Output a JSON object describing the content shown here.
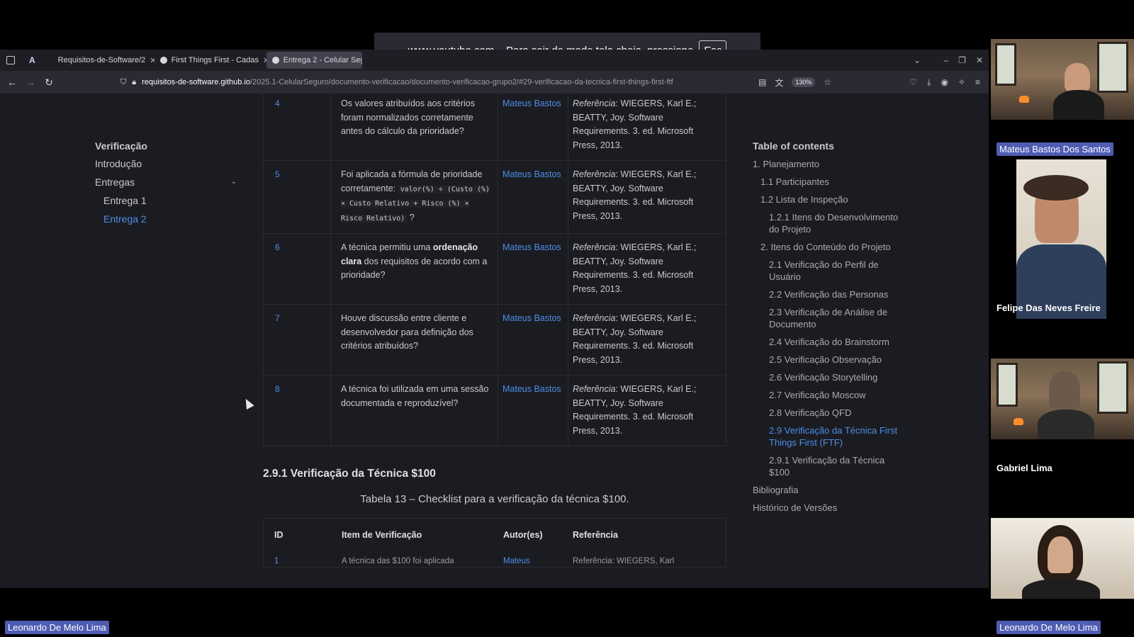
{
  "fullscreen_notice": {
    "text": "www.youtube.com – Para sair do modo tela cheia, pressione",
    "key": "Esc"
  },
  "browser": {
    "tabs": [
      {
        "label": "Requisitos-de-Software/2",
        "icon": "github-icon"
      },
      {
        "label": "First Things First - Cadas",
        "icon": "page-icon"
      },
      {
        "label": "Entrega 2 - Celular Seg",
        "icon": "page-icon"
      }
    ],
    "url_host": "requisitos-de-software.github.io",
    "url_path": "/2025.1-CelularSeguro/documento-verificacao/documento-verificacao-grupo2/#29-verificacao-da-tecnica-first-things-first-ftf",
    "zoom": "130%"
  },
  "sidebar": {
    "title": "Verificação",
    "items": [
      {
        "label": "Introdução"
      },
      {
        "label": "Entregas"
      },
      {
        "label": "Entrega 1"
      },
      {
        "label": "Entrega 2"
      }
    ]
  },
  "checklist_rows": [
    {
      "id": "4",
      "item": "Os valores atribuídos aos critérios foram normalizados corretamente antes do cálculo da prioridade?",
      "author": "Mateus Bastos",
      "ref_label": "Referência",
      "ref": ": WIEGERS, Karl E.; BEATTY, Joy. Software Requirements. 3. ed. Microsoft Press, 2013."
    },
    {
      "id": "5",
      "item_pre": "Foi aplicada a fórmula de prioridade corretamente: ",
      "item_code": "valor(%) ÷ (Custo (%) × Custo Relativo + Risco (%) × Risco Relativo)",
      "item_post": " ?",
      "author": "Mateus Bastos",
      "ref_label": "Referência",
      "ref": ": WIEGERS, Karl E.; BEATTY, Joy. Software Requirements. 3. ed. Microsoft Press, 2013."
    },
    {
      "id": "6",
      "item_pre": "A técnica permitiu uma ",
      "item_bold": "ordenação clara",
      "item_post": " dos requisitos de acordo com a prioridade?",
      "author": "Mateus Bastos",
      "ref_label": "Referência",
      "ref": ": WIEGERS, Karl E.; BEATTY, Joy. Software Requirements. 3. ed. Microsoft Press, 2013."
    },
    {
      "id": "7",
      "item": "Houve discussão entre cliente e desenvolvedor para definição dos critérios atribuídos?",
      "author": "Mateus Bastos",
      "ref_label": "Referência",
      "ref": ": WIEGERS, Karl E.; BEATTY, Joy. Software Requirements. 3. ed. Microsoft Press, 2013."
    },
    {
      "id": "8",
      "item": "A técnica foi utilizada em uma sessão documentada e reproduzível?",
      "author": "Mateus Bastos",
      "ref_label": "Referência",
      "ref": ": WIEGERS, Karl E.; BEATTY, Joy. Software Requirements. 3. ed. Microsoft Press, 2013."
    }
  ],
  "section": {
    "title": "2.9.1 Verificação da Técnica $100",
    "caption": "Tabela 13 – Checklist para a verificação da técnica $100.",
    "headers": [
      "ID",
      "Item de Verificação",
      "Autor(es)",
      "Referência"
    ],
    "peek_row": {
      "id": "1",
      "item": "A técnica das $100 foi aplicada",
      "author": "Mateus",
      "ref": "Referência: WIEGERS, Karl"
    }
  },
  "toc": {
    "title": "Table of contents",
    "entries": [
      {
        "label": "1. Planejamento",
        "level": 1
      },
      {
        "label": "1.1 Participantes",
        "level": 2
      },
      {
        "label": "1.2 Lista de Inspeção",
        "level": 2
      },
      {
        "label": "1.2.1 Itens do Desenvolvimento do Projeto",
        "level": 3
      },
      {
        "label": "2. Itens do Conteúdo do Projeto",
        "level": 2
      },
      {
        "label": "2.1 Verificação do Perfil de Usuário",
        "level": 3
      },
      {
        "label": "2.2 Verificação das Personas",
        "level": 3
      },
      {
        "label": "2.3 Verificação de Análise de Documento",
        "level": 3
      },
      {
        "label": "2.4 Verificação do Brainstorm",
        "level": 3
      },
      {
        "label": "2.5 Verificação Observação",
        "level": 3
      },
      {
        "label": "2.6 Verificação Storytelling",
        "level": 3
      },
      {
        "label": "2.7 Verificação Moscow",
        "level": 3
      },
      {
        "label": "2.8 Verificação QFD",
        "level": 3
      },
      {
        "label": "2.9 Verificação da Técnica First Things First (FTF)",
        "level": 3,
        "active": true
      },
      {
        "label": "2.9.1 Verificação da Técnica $100",
        "level": 3
      },
      {
        "label": "Bibliografia",
        "level": 1
      },
      {
        "label": "Histórico de Versões",
        "level": 1
      }
    ]
  },
  "participants": {
    "p1": "Mateus Bastos Dos Santos",
    "p2": "Felipe Das Neves Freire",
    "p3": "Gabriel Lima",
    "p4": "Leonardo De Melo Lima",
    "bottom_left": "Leonardo De Melo Lima"
  }
}
